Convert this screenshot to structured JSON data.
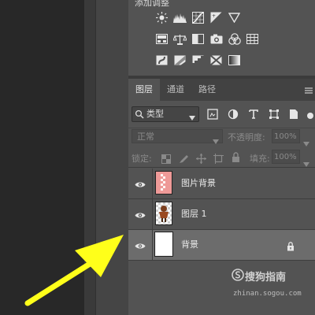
{
  "adjustments": {
    "title": "添加调整",
    "row1_icons": [
      "brightness-icon",
      "levels-icon",
      "curves-icon",
      "exposure-icon",
      "vibrance-triangle-icon"
    ],
    "row2_icons": [
      "hue-saturation-icon",
      "color-balance-icon",
      "black-white-icon",
      "photo-filter-icon",
      "channel-mixer-icon",
      "color-lookup-icon"
    ],
    "row3_icons": [
      "invert-icon",
      "posterize-icon",
      "threshold-icon",
      "selective-color-icon",
      "gradient-map-icon"
    ]
  },
  "tabs": [
    {
      "label": "图层",
      "active": true
    },
    {
      "label": "通道",
      "active": false
    },
    {
      "label": "路径",
      "active": false
    }
  ],
  "filter": {
    "kind_label": "类型"
  },
  "blend": {
    "mode": "正常",
    "opacity_label": "不透明度:",
    "opacity_value": "100%"
  },
  "locks": {
    "label": "锁定:",
    "fill_label": "填充:",
    "fill_value": "100%"
  },
  "layers": [
    {
      "name": "图片背景",
      "thumb": "pink",
      "locked": false,
      "selected": false
    },
    {
      "name": "图层 1",
      "thumb": "figure",
      "locked": false,
      "selected": false
    },
    {
      "name": "背景",
      "thumb": "white",
      "locked": true,
      "selected": true
    }
  ],
  "watermark": {
    "text": "搜狗指南",
    "url": "zhinan.sogou.com"
  },
  "colors": {
    "arrow": "#ffff1a",
    "panel": "#535353",
    "selected_layer": "#6c6c6c"
  }
}
